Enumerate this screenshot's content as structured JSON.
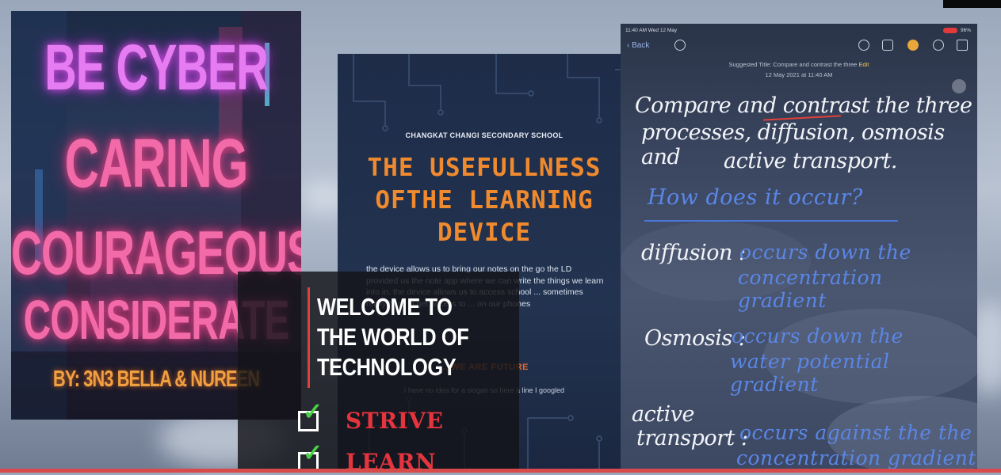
{
  "poster": {
    "line1": "BE CYBER",
    "line2": "CARING",
    "line3": "COURAGEOUS",
    "line4": "CONSIDERATE",
    "byline": "BY: 3N3 BELLA & NUREEN"
  },
  "slide": {
    "school": "CHANGKAT CHANGI SECONDARY SCHOOL",
    "title": "THE USEFULLNESS OFTHE LEARNING DEVICE",
    "body": "the device allows us to bring our notes on the go the LD provided us the note app where we can write the things we learn into in. the device allows us to access school ... sometimes really hard to get access to ... on our phones",
    "slogan": "... WE ARE FUTURE",
    "footer": "I have no idea for a slogan so here a line I googled"
  },
  "welcome": {
    "heading": "WELCOME TO THE WORLD OF TECHNOLOGY",
    "items": [
      "STRIVE",
      "LEARN"
    ]
  },
  "ipad": {
    "time": "11:40 AM  Wed 12 May",
    "battery": "96%",
    "back": "Back",
    "suggested_title": "Suggested Title: Compare and contrast the three",
    "edit": "Edit",
    "date": "12 May 2021 at 11:40 AM",
    "question_l1": "Compare and contrast the three",
    "question_l2": "processes, diffusion, osmosis and",
    "question_l3": "active transport.",
    "subheading": "How does it occur?",
    "entries": [
      {
        "term": "diffusion :",
        "desc1": "occurs down the",
        "desc2": "concentration gradient"
      },
      {
        "term": "Osmosis :",
        "desc1": "occurs down the",
        "desc2": "water potential gradient"
      },
      {
        "term1": "active",
        "term2": "transport :",
        "desc1": "occurs against the the",
        "desc2": "concentration gradient"
      }
    ]
  },
  "colors": {
    "neon_purple": "#e67cf2",
    "neon_pink": "#f26aa8",
    "orange": "#f08a2e",
    "check_green": "#4cd048",
    "red": "#e4343e",
    "ink_blue": "#5a86e6"
  },
  "icons": [
    "check-icon",
    "back-chevron-icon",
    "undo-icon",
    "done-icon",
    "camera-icon",
    "markup-icon",
    "compose-icon"
  ]
}
